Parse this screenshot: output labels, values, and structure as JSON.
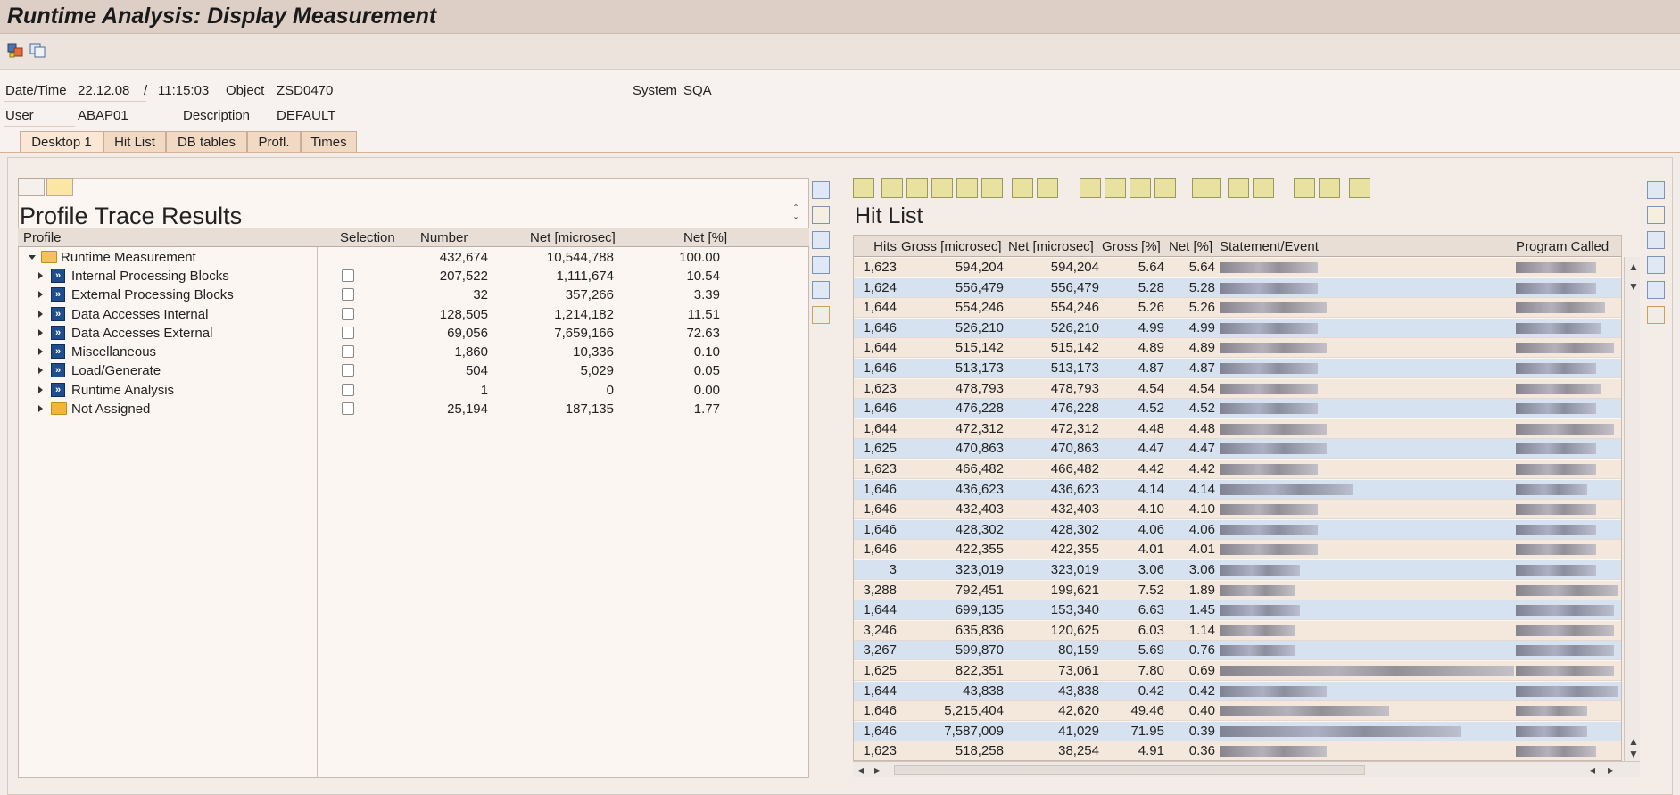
{
  "window": {
    "title": "Runtime Analysis: Display Measurement"
  },
  "header": {
    "datetime_label": "Date/Time",
    "date": "22.12.08",
    "slash": "/",
    "time": "11:15:03",
    "object_label": "Object",
    "object": "ZSD0470",
    "system_label": "System",
    "system": "SQA",
    "user_label": "User",
    "user": "ABAP01",
    "description_label": "Description",
    "description": "DEFAULT"
  },
  "tabs": [
    "Desktop 1",
    "Hit List",
    "DB tables",
    "Profl.",
    "Times"
  ],
  "profile": {
    "title": "Profile Trace Results",
    "columns": [
      "Profile",
      "Selection",
      "Number",
      "Net [microsec]",
      "Net [%]"
    ],
    "rows": [
      {
        "label": "Runtime Measurement",
        "number": "432,674",
        "net": "10,544,788",
        "pct": "100.00"
      },
      {
        "label": "Internal Processing Blocks",
        "number": "207,522",
        "net": "1,111,674",
        "pct": "10.54"
      },
      {
        "label": "External Processing Blocks",
        "number": "32",
        "net": "357,266",
        "pct": "3.39"
      },
      {
        "label": "Data Accesses Internal",
        "number": "128,505",
        "net": "1,214,182",
        "pct": "11.51"
      },
      {
        "label": "Data Accesses External",
        "number": "69,056",
        "net": "7,659,166",
        "pct": "72.63"
      },
      {
        "label": "Miscellaneous",
        "number": "1,860",
        "net": "10,336",
        "pct": "0.10"
      },
      {
        "label": "Load/Generate",
        "number": "504",
        "net": "5,029",
        "pct": "0.05"
      },
      {
        "label": "Runtime Analysis",
        "number": "1",
        "net": "0",
        "pct": "0.00"
      },
      {
        "label": "Not Assigned",
        "number": "25,194",
        "net": "187,135",
        "pct": "1.77"
      }
    ]
  },
  "hitlist": {
    "title": "Hit List",
    "columns": [
      "Hits",
      "Gross [microsec]",
      "Net [microsec]",
      "Gross [%]",
      "Net [%]",
      "Statement/Event",
      "Program Called"
    ],
    "rows": [
      [
        "1,623",
        "594,204",
        "594,204",
        "5.64",
        "5.64"
      ],
      [
        "1,624",
        "556,479",
        "556,479",
        "5.28",
        "5.28"
      ],
      [
        "1,644",
        "554,246",
        "554,246",
        "5.26",
        "5.26"
      ],
      [
        "1,646",
        "526,210",
        "526,210",
        "4.99",
        "4.99"
      ],
      [
        "1,644",
        "515,142",
        "515,142",
        "4.89",
        "4.89"
      ],
      [
        "1,646",
        "513,173",
        "513,173",
        "4.87",
        "4.87"
      ],
      [
        "1,623",
        "478,793",
        "478,793",
        "4.54",
        "4.54"
      ],
      [
        "1,646",
        "476,228",
        "476,228",
        "4.52",
        "4.52"
      ],
      [
        "1,644",
        "472,312",
        "472,312",
        "4.48",
        "4.48"
      ],
      [
        "1,625",
        "470,863",
        "470,863",
        "4.47",
        "4.47"
      ],
      [
        "1,623",
        "466,482",
        "466,482",
        "4.42",
        "4.42"
      ],
      [
        "1,646",
        "436,623",
        "436,623",
        "4.14",
        "4.14"
      ],
      [
        "1,646",
        "432,403",
        "432,403",
        "4.10",
        "4.10"
      ],
      [
        "1,646",
        "428,302",
        "428,302",
        "4.06",
        "4.06"
      ],
      [
        "1,646",
        "422,355",
        "422,355",
        "4.01",
        "4.01"
      ],
      [
        "3",
        "323,019",
        "323,019",
        "3.06",
        "3.06"
      ],
      [
        "3,288",
        "792,451",
        "199,621",
        "7.52",
        "1.89"
      ],
      [
        "1,644",
        "699,135",
        "153,340",
        "6.63",
        "1.45"
      ],
      [
        "3,246",
        "635,836",
        "120,625",
        "6.03",
        "1.14"
      ],
      [
        "3,267",
        "599,870",
        "80,159",
        "5.69",
        "0.76"
      ],
      [
        "1,625",
        "822,351",
        "73,061",
        "7.80",
        "0.69"
      ],
      [
        "1,644",
        "43,838",
        "43,838",
        "0.42",
        "0.42"
      ],
      [
        "1,646",
        "5,215,404",
        "42,620",
        "49.46",
        "0.40"
      ],
      [
        "1,646",
        "7,587,009",
        "41,029",
        "71.95",
        "0.39"
      ],
      [
        "1,623",
        "518,258",
        "38,254",
        "4.91",
        "0.36"
      ]
    ]
  }
}
